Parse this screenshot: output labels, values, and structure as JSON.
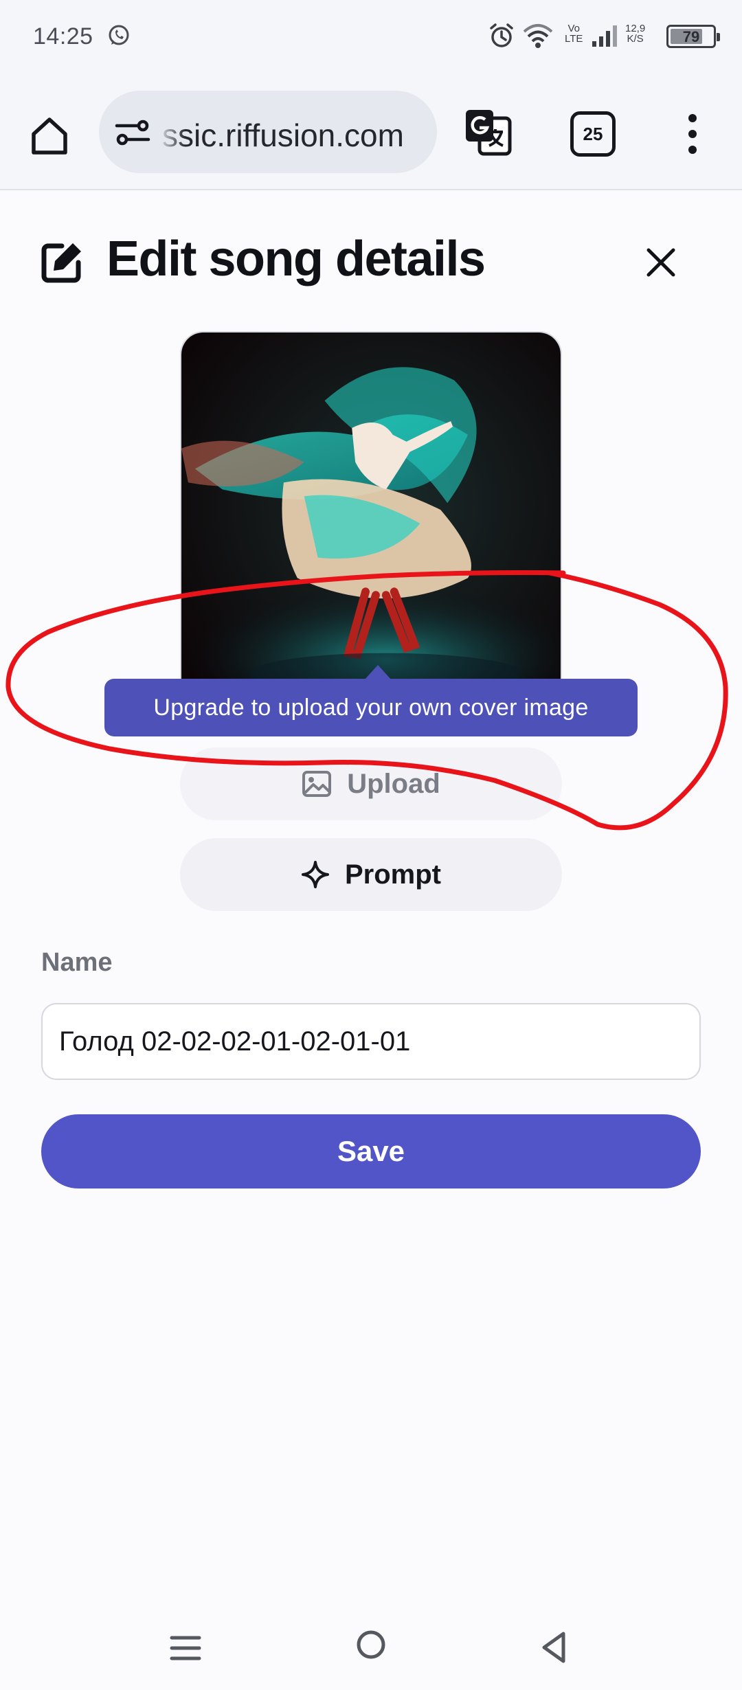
{
  "status_bar": {
    "time": "14:25",
    "network_vo": "Vo",
    "network_lte": "LTE",
    "speed_value": "12,9",
    "speed_unit": "K/S",
    "battery": "79",
    "battery_level": 0.79
  },
  "browser": {
    "url": "ssic.riffusion.com",
    "tab_count": "25"
  },
  "modal": {
    "title": "Edit song details",
    "tooltip": "Upgrade to upload your own cover image",
    "upload_label": "Upload",
    "prompt_label": "Prompt",
    "name_label": "Name",
    "name_value": "Голод 02-02-02-01-02-01-01",
    "save_label": "Save"
  },
  "colors": {
    "accent": "#5155c8",
    "tooltip": "#4e52b8",
    "annotation": "#e8141a"
  },
  "icons": {
    "home": "home-icon",
    "site_settings": "tune-icon",
    "translate": "translate-icon",
    "menu": "more-vert-icon",
    "edit": "edit-square-icon",
    "close": "close-icon",
    "upload": "image-icon",
    "prompt": "sparkle-icon"
  }
}
